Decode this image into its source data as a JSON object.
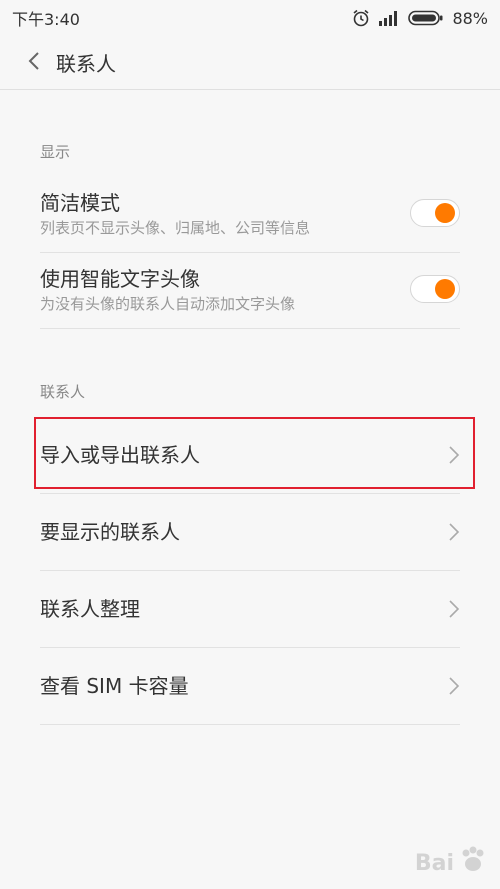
{
  "status_bar": {
    "time": "下午3:40",
    "battery": "88%"
  },
  "header": {
    "title": "联系人"
  },
  "sections": {
    "display": {
      "label": "显示",
      "items": [
        {
          "title": "简洁模式",
          "subtitle": "列表页不显示头像、归属地、公司等信息",
          "enabled": true
        },
        {
          "title": "使用智能文字头像",
          "subtitle": "为没有头像的联系人自动添加文字头像",
          "enabled": true
        }
      ]
    },
    "contacts": {
      "label": "联系人",
      "items": [
        {
          "title": "导入或导出联系人"
        },
        {
          "title": "要显示的联系人"
        },
        {
          "title": "联系人整理"
        },
        {
          "title": "查看 SIM 卡容量"
        }
      ]
    }
  },
  "colors": {
    "accent": "#ff7a00",
    "highlight": "#e1202f"
  },
  "watermark": {
    "text": "Bai"
  }
}
